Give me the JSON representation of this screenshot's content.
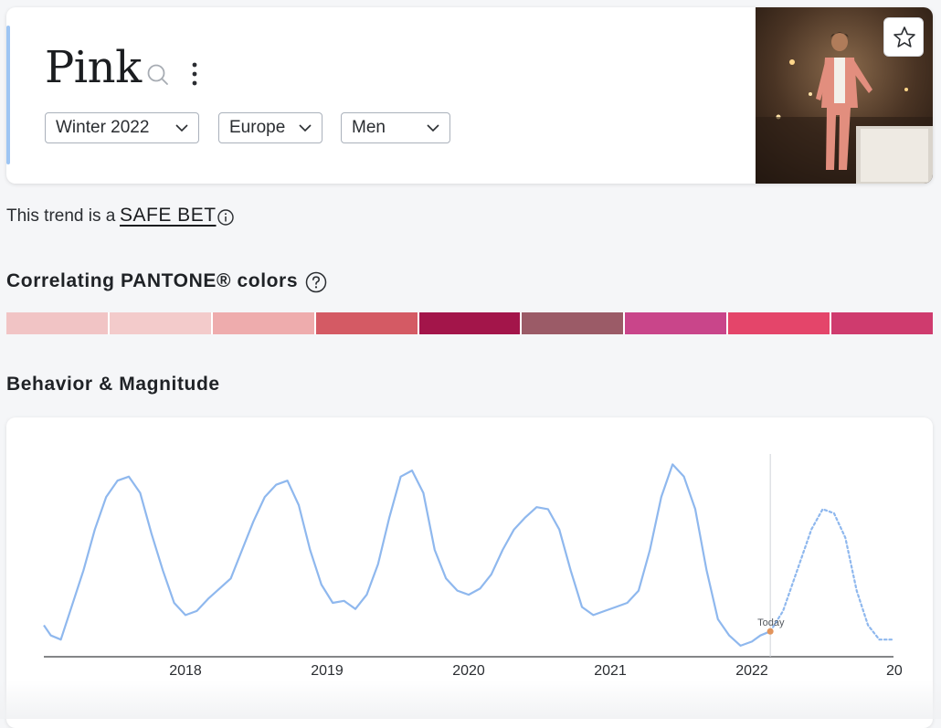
{
  "header": {
    "title": "Pink",
    "filters": [
      {
        "value": "Winter 2022"
      },
      {
        "value": "Europe"
      },
      {
        "value": "Men"
      }
    ]
  },
  "trend": {
    "prefix": "This trend is a",
    "label": "SAFE BET"
  },
  "pantone": {
    "title": "Correlating PANTONE® colors",
    "swatches": [
      "#f1c4c5",
      "#f3cbcb",
      "#eeacad",
      "#d45a64",
      "#a3154a",
      "#9b5b67",
      "#c9458a",
      "#e4456a",
      "#cf3b6e"
    ]
  },
  "behavior": {
    "title": "Behavior & Magnitude"
  },
  "colors": {
    "line": "#8fb8ee",
    "today_marker": "#e2945c",
    "accent": "#9ec5f3"
  },
  "chart_data": {
    "type": "line",
    "x_ticks": [
      "2018",
      "2019",
      "2020",
      "2021",
      "2022",
      "20"
    ],
    "today_label": "Today",
    "today": 2022.13,
    "xlim": [
      2017.0,
      2023.0
    ],
    "ylim": [
      0,
      100
    ],
    "grid": false,
    "series": [
      {
        "style": "solid",
        "points": [
          [
            2017.0,
            15
          ],
          [
            2017.05,
            10
          ],
          [
            2017.12,
            8
          ],
          [
            2017.2,
            25
          ],
          [
            2017.28,
            42
          ],
          [
            2017.36,
            62
          ],
          [
            2017.44,
            78
          ],
          [
            2017.52,
            86
          ],
          [
            2017.6,
            88
          ],
          [
            2017.68,
            80
          ],
          [
            2017.76,
            60
          ],
          [
            2017.84,
            42
          ],
          [
            2017.92,
            26
          ],
          [
            2018.0,
            20
          ],
          [
            2018.08,
            22
          ],
          [
            2018.16,
            28
          ],
          [
            2018.24,
            33
          ],
          [
            2018.32,
            38
          ],
          [
            2018.4,
            52
          ],
          [
            2018.48,
            66
          ],
          [
            2018.56,
            78
          ],
          [
            2018.64,
            84
          ],
          [
            2018.72,
            86
          ],
          [
            2018.8,
            74
          ],
          [
            2018.88,
            52
          ],
          [
            2018.96,
            35
          ],
          [
            2019.04,
            26
          ],
          [
            2019.12,
            27
          ],
          [
            2019.2,
            23
          ],
          [
            2019.28,
            30
          ],
          [
            2019.36,
            45
          ],
          [
            2019.44,
            68
          ],
          [
            2019.52,
            88
          ],
          [
            2019.6,
            91
          ],
          [
            2019.68,
            80
          ],
          [
            2019.76,
            52
          ],
          [
            2019.84,
            38
          ],
          [
            2019.92,
            32
          ],
          [
            2020.0,
            30
          ],
          [
            2020.08,
            33
          ],
          [
            2020.16,
            40
          ],
          [
            2020.24,
            52
          ],
          [
            2020.32,
            62
          ],
          [
            2020.4,
            68
          ],
          [
            2020.48,
            73
          ],
          [
            2020.56,
            72
          ],
          [
            2020.64,
            62
          ],
          [
            2020.72,
            42
          ],
          [
            2020.8,
            24
          ],
          [
            2020.88,
            20
          ],
          [
            2020.96,
            22
          ],
          [
            2021.04,
            24
          ],
          [
            2021.12,
            26
          ],
          [
            2021.2,
            32
          ],
          [
            2021.28,
            52
          ],
          [
            2021.36,
            78
          ],
          [
            2021.44,
            94
          ],
          [
            2021.52,
            88
          ],
          [
            2021.6,
            72
          ],
          [
            2021.68,
            42
          ],
          [
            2021.76,
            18
          ],
          [
            2021.84,
            10
          ],
          [
            2021.92,
            5
          ],
          [
            2022.0,
            7
          ],
          [
            2022.06,
            10
          ],
          [
            2022.13,
            12
          ]
        ]
      },
      {
        "style": "dotted",
        "points": [
          [
            2022.13,
            12
          ],
          [
            2022.22,
            22
          ],
          [
            2022.32,
            42
          ],
          [
            2022.42,
            62
          ],
          [
            2022.5,
            72
          ],
          [
            2022.58,
            70
          ],
          [
            2022.66,
            58
          ],
          [
            2022.74,
            32
          ],
          [
            2022.82,
            15
          ],
          [
            2022.9,
            8
          ],
          [
            2023.0,
            8
          ]
        ]
      }
    ]
  }
}
